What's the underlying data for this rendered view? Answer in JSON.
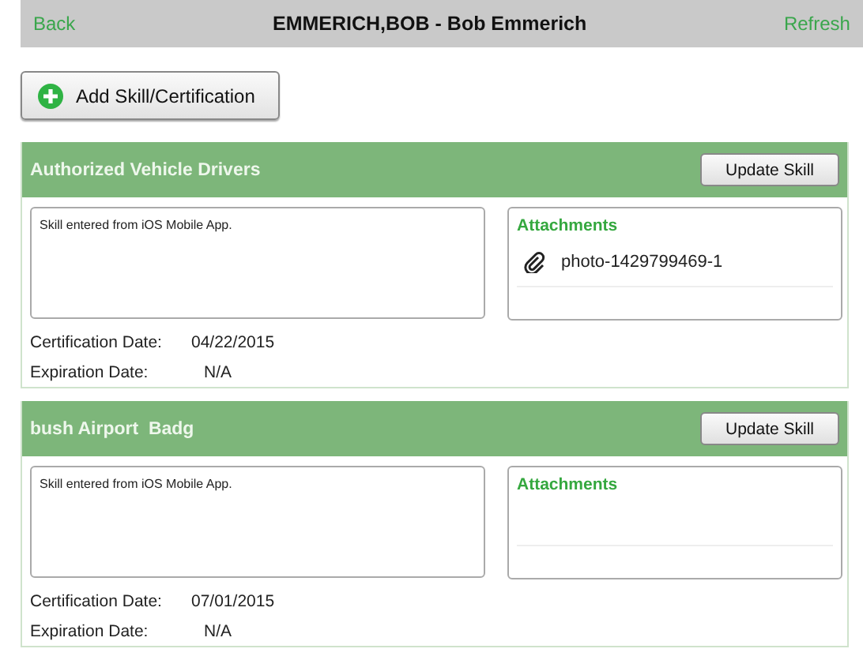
{
  "nav": {
    "back": "Back",
    "title": "EMMERICH,BOB - Bob Emmerich",
    "refresh": "Refresh"
  },
  "add_button": {
    "label": "Add Skill/Certification"
  },
  "skills": [
    {
      "name": "Authorized Vehicle Drivers",
      "button": "Update Skill",
      "notes": "Skill entered from iOS Mobile App.",
      "attachments_title": "Attachments",
      "attachments": [
        "photo-1429799469-1"
      ],
      "certification_label": "Certification Date:",
      "certification_date": "04/22/2015",
      "expiration_label": "Expiration Date:",
      "expiration_date": "N/A"
    },
    {
      "name": "bush Airport  Badg",
      "button": "Update Skill",
      "notes": "Skill entered from iOS Mobile App.",
      "attachments_title": "Attachments",
      "certification_label": "Certification Date:",
      "certification_date": "07/01/2015",
      "expiration_label": "Expiration Date:",
      "expiration_date": "N/A"
    }
  ]
}
